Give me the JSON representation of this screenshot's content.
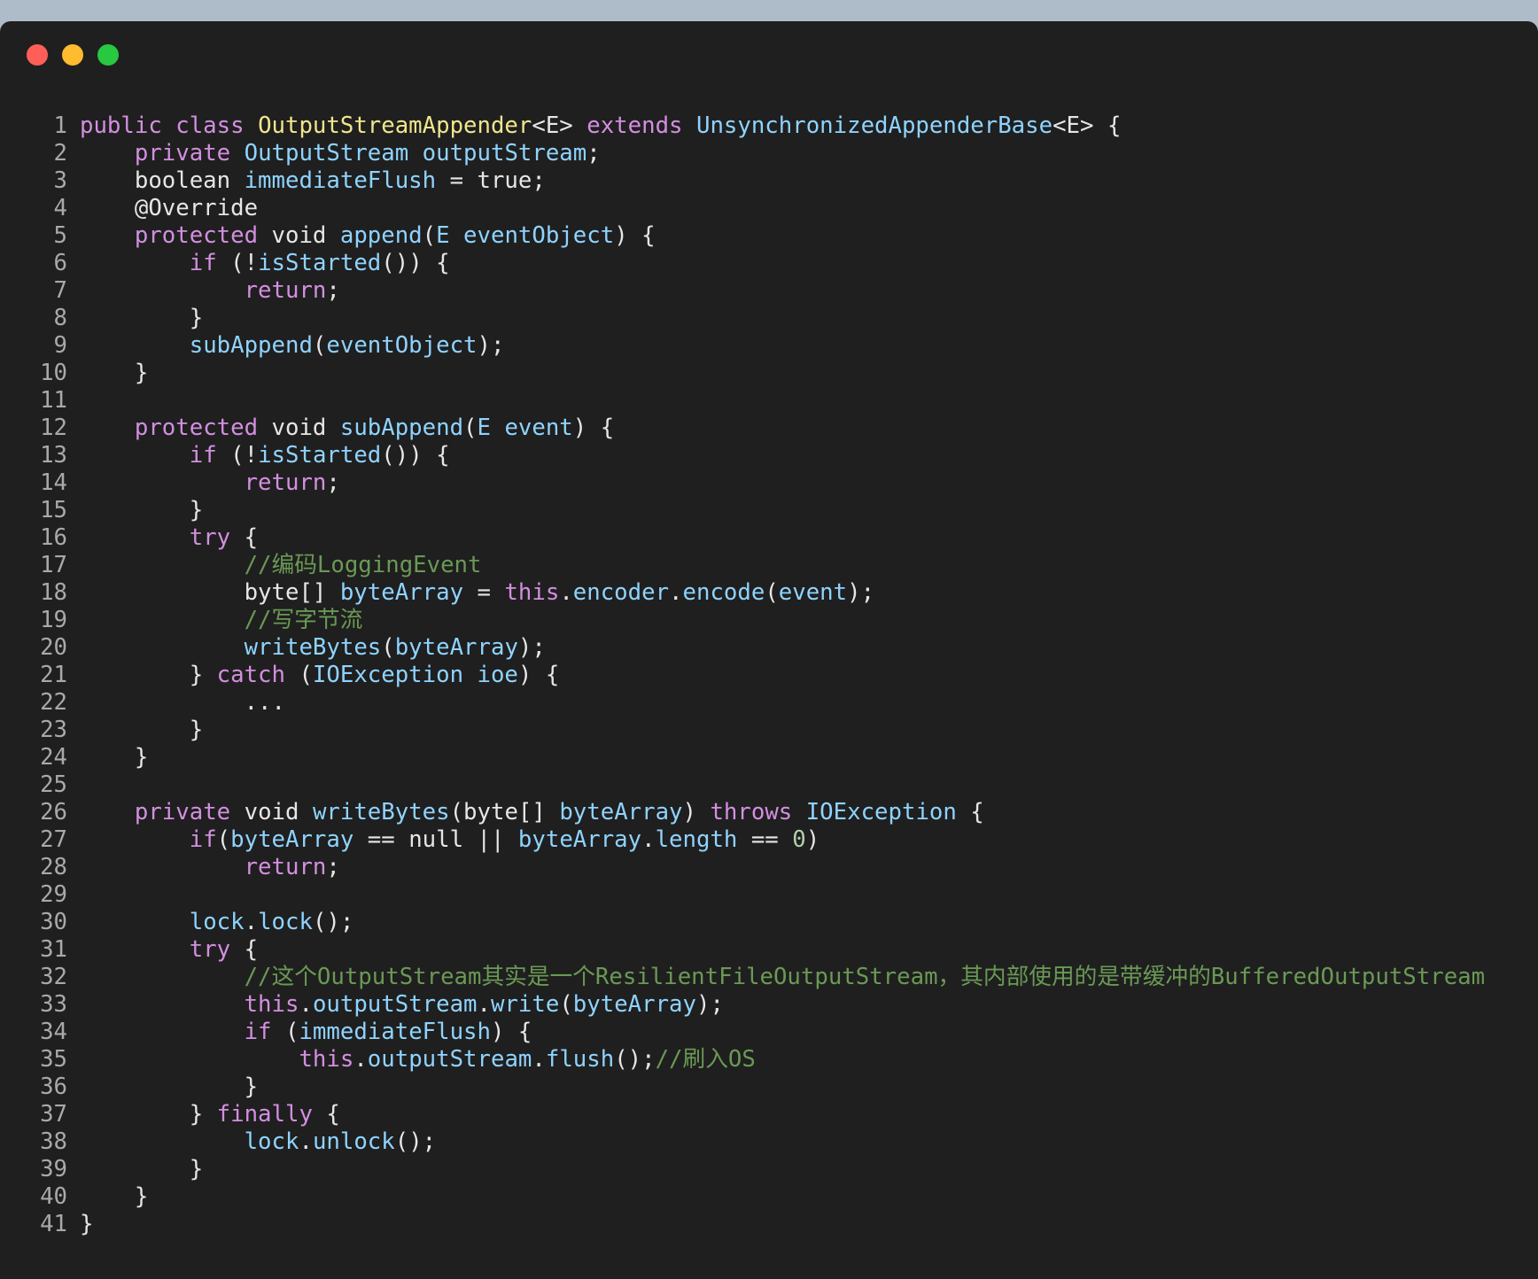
{
  "window": {
    "traffic_lights": [
      {
        "name": "close",
        "color": "#ff5f57"
      },
      {
        "name": "minimize",
        "color": "#febc2e"
      },
      {
        "name": "zoom",
        "color": "#28c840"
      }
    ]
  },
  "colors": {
    "background": "#1f1f1f",
    "plain": "#e6e6e6",
    "keyword": "#d38fe0",
    "type": "#8fd3ff",
    "class_name": "#f0e68c",
    "comment": "#6a9955",
    "number": "#b5cea8",
    "line_number": "#a9a9a9"
  },
  "code_lines": [
    {
      "n": "1",
      "tokens": [
        [
          "public class ",
          "keyword"
        ],
        [
          "OutputStreamAppender",
          "class_name"
        ],
        [
          "<E> ",
          "plain"
        ],
        [
          "extends ",
          "keyword"
        ],
        [
          "UnsynchronizedAppenderBase",
          "type"
        ],
        [
          "<E> {",
          "plain"
        ]
      ]
    },
    {
      "n": "2",
      "tokens": [
        [
          "    ",
          "plain"
        ],
        [
          "private ",
          "keyword"
        ],
        [
          "OutputStream outputStream",
          "type"
        ],
        [
          ";",
          "plain"
        ]
      ]
    },
    {
      "n": "3",
      "tokens": [
        [
          "    boolean ",
          "plain"
        ],
        [
          "immediateFlush",
          "type"
        ],
        [
          " = true;",
          "plain"
        ]
      ]
    },
    {
      "n": "4",
      "tokens": [
        [
          "    @Override",
          "plain"
        ]
      ]
    },
    {
      "n": "5",
      "tokens": [
        [
          "    ",
          "plain"
        ],
        [
          "protected ",
          "keyword"
        ],
        [
          "void ",
          "plain"
        ],
        [
          "append",
          "type"
        ],
        [
          "(",
          "plain"
        ],
        [
          "E eventObject",
          "type"
        ],
        [
          ") {",
          "plain"
        ]
      ]
    },
    {
      "n": "6",
      "tokens": [
        [
          "        ",
          "plain"
        ],
        [
          "if ",
          "keyword"
        ],
        [
          "(!",
          "plain"
        ],
        [
          "isStarted",
          "type"
        ],
        [
          "()) {",
          "plain"
        ]
      ]
    },
    {
      "n": "7",
      "tokens": [
        [
          "            ",
          "plain"
        ],
        [
          "return",
          "keyword"
        ],
        [
          ";",
          "plain"
        ]
      ]
    },
    {
      "n": "8",
      "tokens": [
        [
          "        }",
          "plain"
        ]
      ]
    },
    {
      "n": "9",
      "tokens": [
        [
          "        ",
          "plain"
        ],
        [
          "subAppend",
          "type"
        ],
        [
          "(",
          "plain"
        ],
        [
          "eventObject",
          "type"
        ],
        [
          ");",
          "plain"
        ]
      ]
    },
    {
      "n": "10",
      "tokens": [
        [
          "    }",
          "plain"
        ]
      ]
    },
    {
      "n": "11",
      "tokens": []
    },
    {
      "n": "12",
      "tokens": [
        [
          "    ",
          "plain"
        ],
        [
          "protected ",
          "keyword"
        ],
        [
          "void ",
          "plain"
        ],
        [
          "subAppend",
          "type"
        ],
        [
          "(",
          "plain"
        ],
        [
          "E event",
          "type"
        ],
        [
          ") {",
          "plain"
        ]
      ]
    },
    {
      "n": "13",
      "tokens": [
        [
          "        ",
          "plain"
        ],
        [
          "if ",
          "keyword"
        ],
        [
          "(!",
          "plain"
        ],
        [
          "isStarted",
          "type"
        ],
        [
          "()) {",
          "plain"
        ]
      ]
    },
    {
      "n": "14",
      "tokens": [
        [
          "            ",
          "plain"
        ],
        [
          "return",
          "keyword"
        ],
        [
          ";",
          "plain"
        ]
      ]
    },
    {
      "n": "15",
      "tokens": [
        [
          "        }",
          "plain"
        ]
      ]
    },
    {
      "n": "16",
      "tokens": [
        [
          "        ",
          "plain"
        ],
        [
          "try ",
          "keyword"
        ],
        [
          "{",
          "plain"
        ]
      ]
    },
    {
      "n": "17",
      "tokens": [
        [
          "            ",
          "plain"
        ],
        [
          "//编码LoggingEvent",
          "comment"
        ]
      ]
    },
    {
      "n": "18",
      "tokens": [
        [
          "            byte[] ",
          "plain"
        ],
        [
          "byteArray",
          "type"
        ],
        [
          " = ",
          "plain"
        ],
        [
          "this",
          "keyword"
        ],
        [
          ".",
          "plain"
        ],
        [
          "encoder",
          "type"
        ],
        [
          ".",
          "plain"
        ],
        [
          "encode",
          "type"
        ],
        [
          "(",
          "plain"
        ],
        [
          "event",
          "type"
        ],
        [
          ");",
          "plain"
        ]
      ]
    },
    {
      "n": "19",
      "tokens": [
        [
          "            ",
          "plain"
        ],
        [
          "//写字节流",
          "comment"
        ]
      ]
    },
    {
      "n": "20",
      "tokens": [
        [
          "            ",
          "plain"
        ],
        [
          "writeBytes",
          "type"
        ],
        [
          "(",
          "plain"
        ],
        [
          "byteArray",
          "type"
        ],
        [
          ");",
          "plain"
        ]
      ]
    },
    {
      "n": "21",
      "tokens": [
        [
          "        } ",
          "plain"
        ],
        [
          "catch ",
          "keyword"
        ],
        [
          "(",
          "plain"
        ],
        [
          "IOException ioe",
          "type"
        ],
        [
          ") {",
          "plain"
        ]
      ]
    },
    {
      "n": "22",
      "tokens": [
        [
          "            ...",
          "plain"
        ]
      ]
    },
    {
      "n": "23",
      "tokens": [
        [
          "        }",
          "plain"
        ]
      ]
    },
    {
      "n": "24",
      "tokens": [
        [
          "    }",
          "plain"
        ]
      ]
    },
    {
      "n": "25",
      "tokens": []
    },
    {
      "n": "26",
      "tokens": [
        [
          "    ",
          "plain"
        ],
        [
          "private ",
          "keyword"
        ],
        [
          "void ",
          "plain"
        ],
        [
          "writeBytes",
          "type"
        ],
        [
          "(byte[] ",
          "plain"
        ],
        [
          "byteArray",
          "type"
        ],
        [
          ") ",
          "plain"
        ],
        [
          "throws ",
          "keyword"
        ],
        [
          "IOException",
          "type"
        ],
        [
          " {",
          "plain"
        ]
      ]
    },
    {
      "n": "27",
      "tokens": [
        [
          "        ",
          "plain"
        ],
        [
          "if",
          "keyword"
        ],
        [
          "(",
          "plain"
        ],
        [
          "byteArray",
          "type"
        ],
        [
          " == null || ",
          "plain"
        ],
        [
          "byteArray",
          "type"
        ],
        [
          ".",
          "plain"
        ],
        [
          "length",
          "type"
        ],
        [
          " == ",
          "plain"
        ],
        [
          "0",
          "number"
        ],
        [
          ")",
          "plain"
        ]
      ]
    },
    {
      "n": "28",
      "tokens": [
        [
          "            ",
          "plain"
        ],
        [
          "return",
          "keyword"
        ],
        [
          ";",
          "plain"
        ]
      ]
    },
    {
      "n": "29",
      "tokens": []
    },
    {
      "n": "30",
      "tokens": [
        [
          "        ",
          "plain"
        ],
        [
          "lock",
          "type"
        ],
        [
          ".",
          "plain"
        ],
        [
          "lock",
          "type"
        ],
        [
          "();",
          "plain"
        ]
      ]
    },
    {
      "n": "31",
      "tokens": [
        [
          "        ",
          "plain"
        ],
        [
          "try ",
          "keyword"
        ],
        [
          "{",
          "plain"
        ]
      ]
    },
    {
      "n": "32",
      "tokens": [
        [
          "            ",
          "plain"
        ],
        [
          "//这个OutputStream其实是一个ResilientFileOutputStream，其内部使用的是带缓冲的BufferedOutputStream",
          "comment"
        ]
      ]
    },
    {
      "n": "33",
      "tokens": [
        [
          "            ",
          "plain"
        ],
        [
          "this",
          "keyword"
        ],
        [
          ".",
          "plain"
        ],
        [
          "outputStream",
          "type"
        ],
        [
          ".",
          "plain"
        ],
        [
          "write",
          "type"
        ],
        [
          "(",
          "plain"
        ],
        [
          "byteArray",
          "type"
        ],
        [
          ");",
          "plain"
        ]
      ]
    },
    {
      "n": "34",
      "tokens": [
        [
          "            ",
          "plain"
        ],
        [
          "if ",
          "keyword"
        ],
        [
          "(",
          "plain"
        ],
        [
          "immediateFlush",
          "type"
        ],
        [
          ") {",
          "plain"
        ]
      ]
    },
    {
      "n": "35",
      "tokens": [
        [
          "                ",
          "plain"
        ],
        [
          "this",
          "keyword"
        ],
        [
          ".",
          "plain"
        ],
        [
          "outputStream",
          "type"
        ],
        [
          ".",
          "plain"
        ],
        [
          "flush",
          "type"
        ],
        [
          "();",
          "plain"
        ],
        [
          "//刷入OS",
          "comment"
        ]
      ]
    },
    {
      "n": "36",
      "tokens": [
        [
          "            }",
          "plain"
        ]
      ]
    },
    {
      "n": "37",
      "tokens": [
        [
          "        } ",
          "plain"
        ],
        [
          "finally ",
          "keyword"
        ],
        [
          "{",
          "plain"
        ]
      ]
    },
    {
      "n": "38",
      "tokens": [
        [
          "            ",
          "plain"
        ],
        [
          "lock",
          "type"
        ],
        [
          ".",
          "plain"
        ],
        [
          "unlock",
          "type"
        ],
        [
          "();",
          "plain"
        ]
      ]
    },
    {
      "n": "39",
      "tokens": [
        [
          "        }",
          "plain"
        ]
      ]
    },
    {
      "n": "40",
      "tokens": [
        [
          "    }",
          "plain"
        ]
      ]
    },
    {
      "n": "41",
      "tokens": [
        [
          "}",
          "plain"
        ]
      ]
    }
  ]
}
